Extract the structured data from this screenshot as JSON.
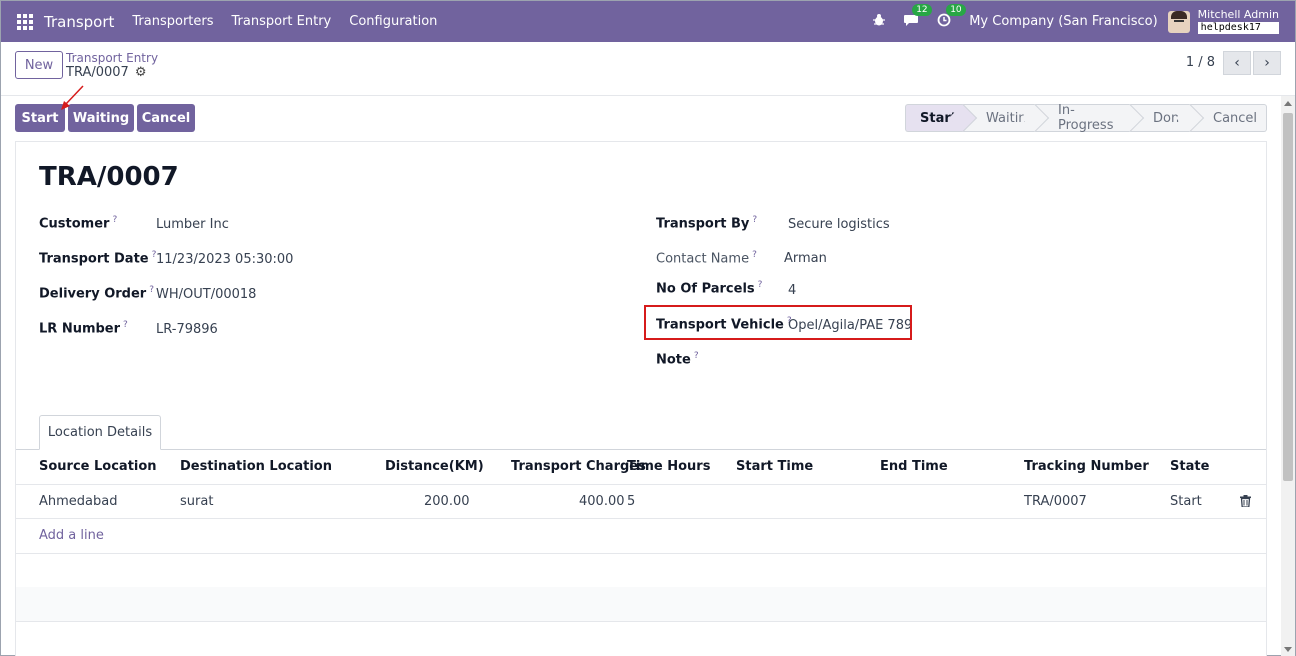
{
  "nav": {
    "app_title": "Transport",
    "menu": [
      "Transporters",
      "Transport Entry",
      "Configuration"
    ],
    "messages_count": "12",
    "activity_count": "10",
    "company": "My Company (San Francisco)",
    "user_name": "Mitchell Admin",
    "database": "helpdesk17"
  },
  "control": {
    "new_label": "New",
    "breadcrumb": "Transport Entry",
    "record": "TRA/0007",
    "pager": "1 / 8"
  },
  "actions": [
    "Start",
    "Waiting",
    "Cancel"
  ],
  "stages": [
    "Start",
    "Waiting",
    "In-Progress",
    "Done",
    "Cancel"
  ],
  "active_stage": "Start",
  "form": {
    "title": "TRA/0007",
    "left": [
      {
        "label": "Customer",
        "value": "Lumber Inc"
      },
      {
        "label": "Transport Date",
        "value": "11/23/2023 05:30:00"
      },
      {
        "label": "Delivery Order",
        "value": "WH/OUT/00018"
      },
      {
        "label": "LR Number",
        "value": "LR-79896"
      }
    ],
    "right": [
      {
        "label": "Transport By",
        "value": "Secure logistics"
      },
      {
        "label": "Contact Name",
        "value": "Arman"
      },
      {
        "label": "No Of Parcels",
        "value": "4"
      },
      {
        "label": "Transport Vehicle",
        "value": "Opel/Agila/PAE 789"
      },
      {
        "label": "Note",
        "value": ""
      }
    ],
    "help_mark": "?"
  },
  "tab": {
    "label": "Location Details"
  },
  "table": {
    "headers": [
      "Source Location",
      "Destination Location",
      "Distance(KM)",
      "Transport Charges",
      "Time Hours",
      "Start Time",
      "End Time",
      "Tracking Number",
      "State"
    ],
    "rows": [
      [
        "Ahmedabad",
        "surat",
        "200.00",
        "400.00",
        "5",
        "",
        "",
        "TRA/0007",
        "Start"
      ]
    ],
    "add_line": "Add a line"
  },
  "colors": {
    "brand": "#71639e",
    "highlight": "#d61b1b",
    "badge": "#28a745"
  }
}
